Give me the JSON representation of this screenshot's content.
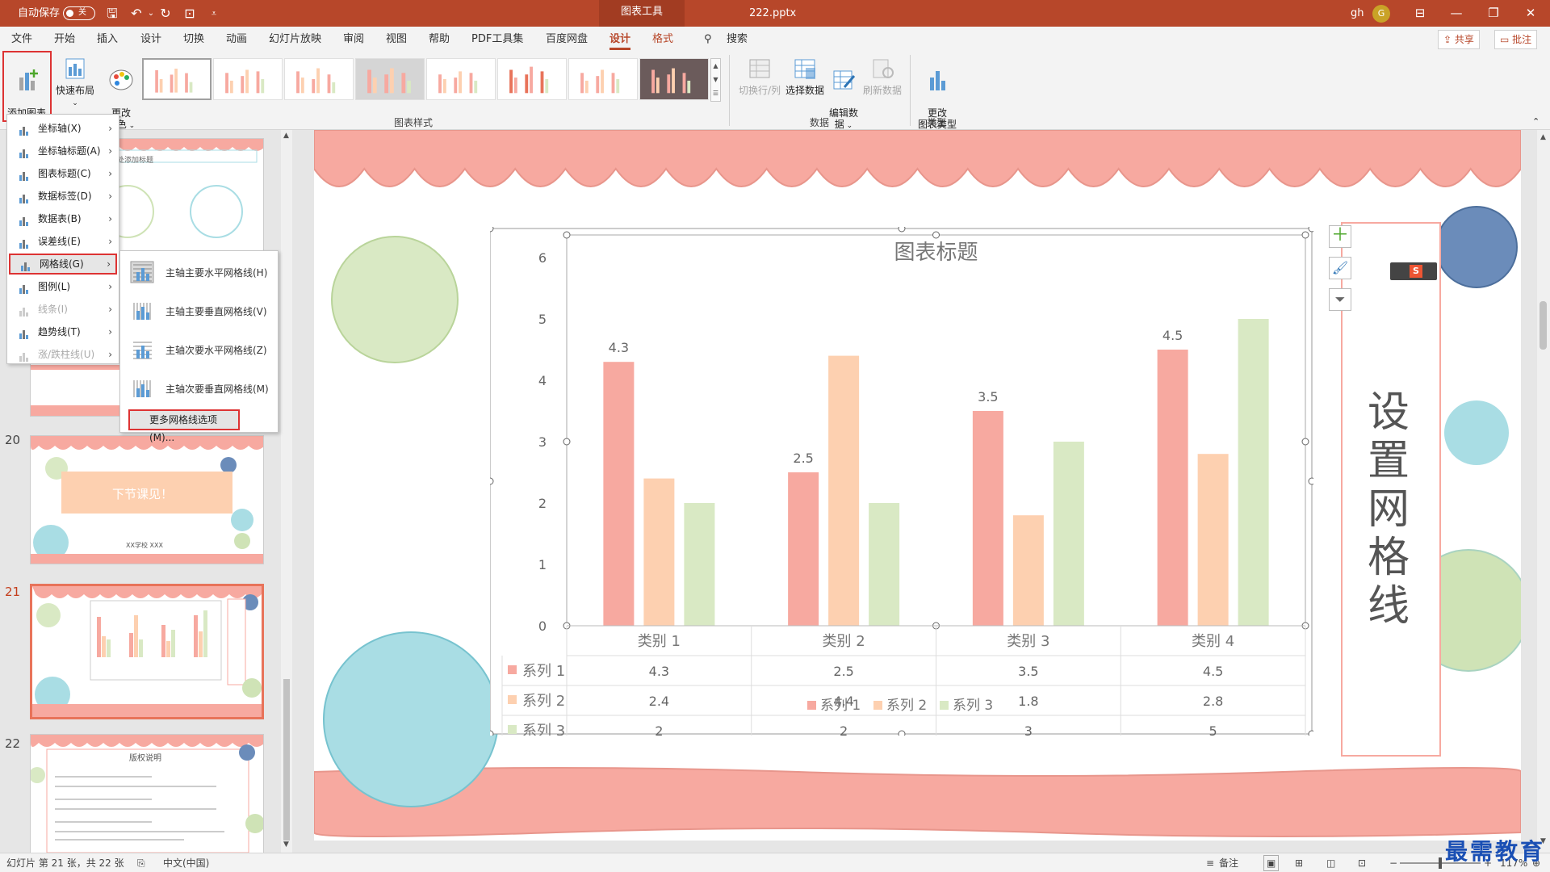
{
  "titlebar": {
    "autosave_label": "自动保存",
    "autosave_state": "关",
    "context_tab": "图表工具",
    "filename": "222.pptx",
    "user": "gh",
    "avatar_initial": "G"
  },
  "tabs": [
    "文件",
    "开始",
    "插入",
    "设计",
    "切换",
    "动画",
    "幻灯片放映",
    "审阅",
    "视图",
    "帮助",
    "PDF工具集",
    "百度网盘",
    "设计",
    "格式"
  ],
  "active_tab_index": 12,
  "search_label": "搜索",
  "share_label": "共享",
  "comment_label": "批注",
  "ribbon": {
    "add_element": "添加图表\n元素",
    "quick_layout": "快速布局",
    "change_color": "更改\n颜色",
    "styles_group": "图表样式",
    "switch_rowcol": "切换行/列",
    "select_data": "选择数据",
    "edit_data": "编辑数\n据",
    "refresh_data": "刷新数据",
    "data_group": "数据",
    "change_type": "更改\n图表类型",
    "type_group": "类型"
  },
  "dropdown": {
    "items": [
      {
        "label": "坐标轴(X)",
        "disabled": false
      },
      {
        "label": "坐标轴标题(A)",
        "disabled": false
      },
      {
        "label": "图表标题(C)",
        "disabled": false
      },
      {
        "label": "数据标签(D)",
        "disabled": false
      },
      {
        "label": "数据表(B)",
        "disabled": false
      },
      {
        "label": "误差线(E)",
        "disabled": false
      },
      {
        "label": "网格线(G)",
        "disabled": false
      },
      {
        "label": "图例(L)",
        "disabled": false
      },
      {
        "label": "线条(I)",
        "disabled": true
      },
      {
        "label": "趋势线(T)",
        "disabled": false
      },
      {
        "label": "涨/跌柱线(U)",
        "disabled": true
      }
    ],
    "highlight_index": 6
  },
  "submenu": {
    "items": [
      "主轴主要水平网格线(H)",
      "主轴主要垂直网格线(V)",
      "主轴次要水平网格线(Z)",
      "主轴次要垂直网格线(M)"
    ],
    "more": "更多网格线选项(M)..."
  },
  "slides": {
    "numbers": [
      "20",
      "21",
      "22"
    ],
    "thumb19_title": "单击此处添加标题",
    "thumb20_text": "下节课见！",
    "thumb20_school": "XX学校 XXX",
    "thumb22_title": "版权说明"
  },
  "slide": {
    "side_text": "设置网格线"
  },
  "chart_data": {
    "type": "bar",
    "title": "图表标题",
    "categories": [
      "类别 1",
      "类别 2",
      "类别 3",
      "类别 4"
    ],
    "series": [
      {
        "name": "系列 1",
        "values": [
          4.3,
          2.5,
          3.5,
          4.5
        ],
        "color": "#f7a9a0"
      },
      {
        "name": "系列 2",
        "values": [
          2.4,
          4.4,
          1.8,
          2.8
        ],
        "color": "#fdd0b0"
      },
      {
        "name": "系列 3",
        "values": [
          2,
          2,
          3,
          5
        ],
        "color": "#d9e9c4"
      }
    ],
    "data_labels_series": "系列 1",
    "ylim": [
      0,
      6
    ],
    "yticks": [
      "0",
      "1",
      "2",
      "3",
      "4",
      "5",
      "6"
    ],
    "data_table": true,
    "legend": "bottom",
    "xlabel": "",
    "ylabel": ""
  },
  "status": {
    "slide_info": "幻灯片 第 21 张，共 22 张",
    "language": "中文(中国)",
    "notes": "备注",
    "zoom": "117%"
  },
  "watermark": "最需教育"
}
